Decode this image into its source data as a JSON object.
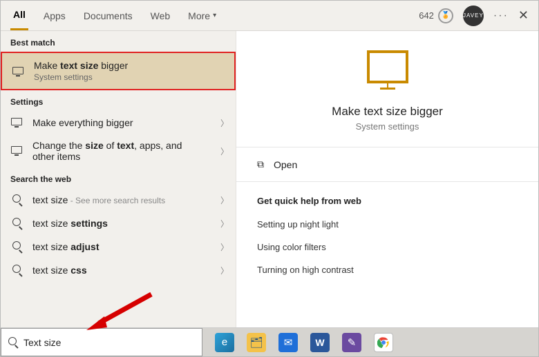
{
  "tabs": {
    "items": [
      "All",
      "Apps",
      "Documents",
      "Web",
      "More"
    ],
    "active_index": 0
  },
  "header": {
    "rewards_points": "642",
    "avatar_text": "JAVEY"
  },
  "left": {
    "best_match": {
      "heading": "Best match",
      "title_pre": "Make ",
      "title_bold": "text size",
      "title_post": " bigger",
      "subtitle": "System settings"
    },
    "settings": {
      "heading": "Settings",
      "items": [
        {
          "html": "Make everything bigger"
        },
        {
          "html_pre": "Change the ",
          "html_bold": "size",
          "html_mid": " of ",
          "html_bold2": "text",
          "html_post": ", apps, and other items"
        }
      ]
    },
    "web": {
      "heading": "Search the web",
      "items": [
        {
          "pre": "text size",
          "hint": " - See more search results"
        },
        {
          "pre": "text size ",
          "bold": "settings"
        },
        {
          "pre": "text size ",
          "bold": "adjust"
        },
        {
          "pre": "text size ",
          "bold": "css"
        }
      ]
    }
  },
  "right": {
    "title": "Make text size bigger",
    "subtitle": "System settings",
    "open_label": "Open",
    "quick_heading": "Get quick help from web",
    "quick_items": [
      "Setting up night light",
      "Using color filters",
      "Turning on high contrast"
    ]
  },
  "search": {
    "value": "Text size"
  },
  "colors": {
    "accent": "#c98a00",
    "highlight_border": "#e02020"
  }
}
